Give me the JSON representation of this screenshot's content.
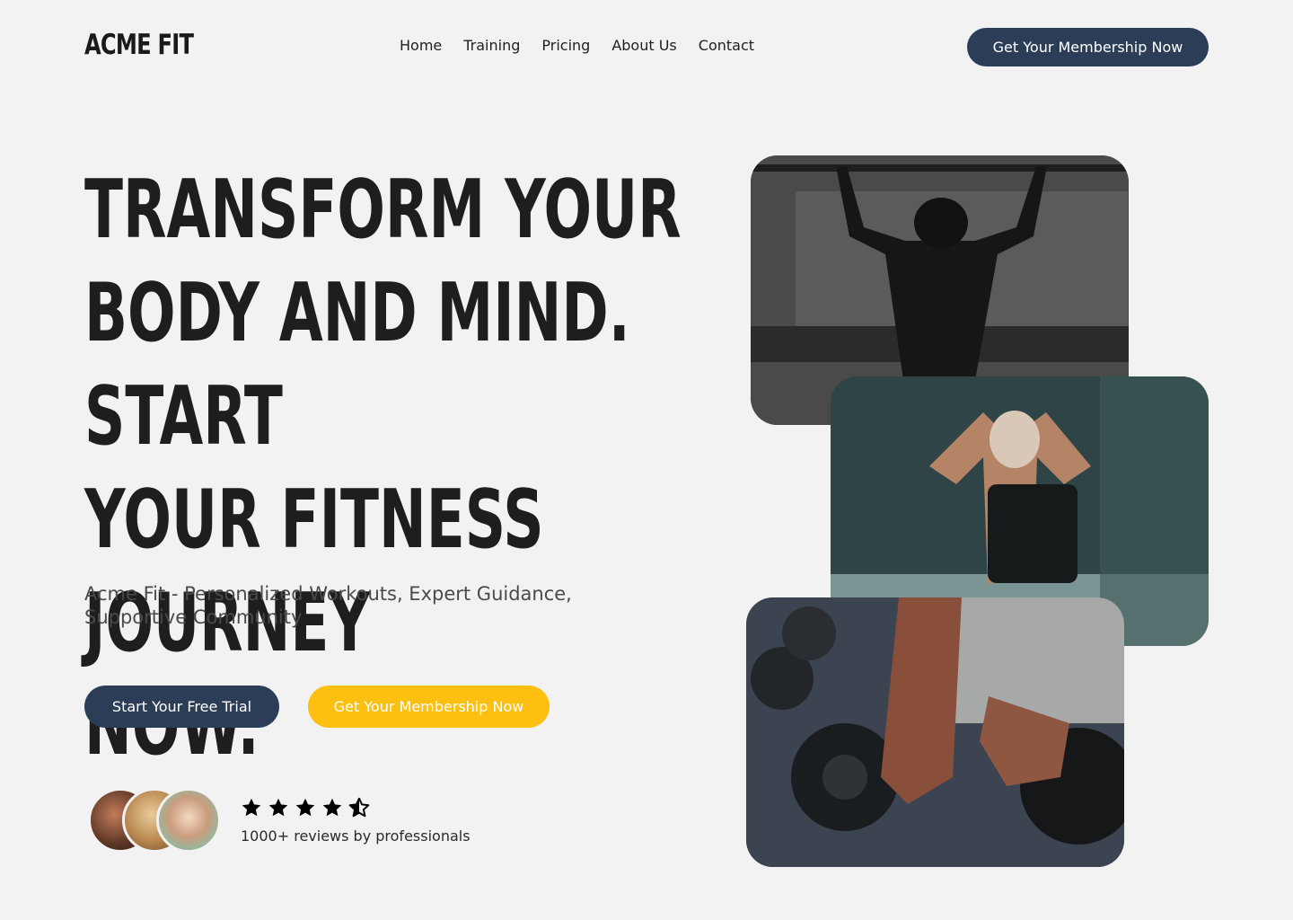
{
  "header": {
    "logo": "ACME FIT",
    "nav": [
      "Home",
      "Training",
      "Pricing",
      "About Us",
      "Contact"
    ],
    "cta": "Get Your Membership Now"
  },
  "hero": {
    "headline": [
      "TRANSFORM YOUR",
      "BODY AND MIND. START",
      "YOUR FITNESS JOURNEY",
      "NOW."
    ],
    "subtitle_line1": "Acme Fit - Personalized Workouts, Expert Guidance,",
    "subtitle_line2": "Supportive Community",
    "primary_cta": "Start Your Free Trial",
    "secondary_cta": "Get Your Membership Now"
  },
  "reviews": {
    "rating": 4.5,
    "text": "1000+ reviews by professionals"
  },
  "colors": {
    "background": "#f2f2f2",
    "dark_button": "#2c3e57",
    "accent_yellow": "#fdbf10"
  }
}
